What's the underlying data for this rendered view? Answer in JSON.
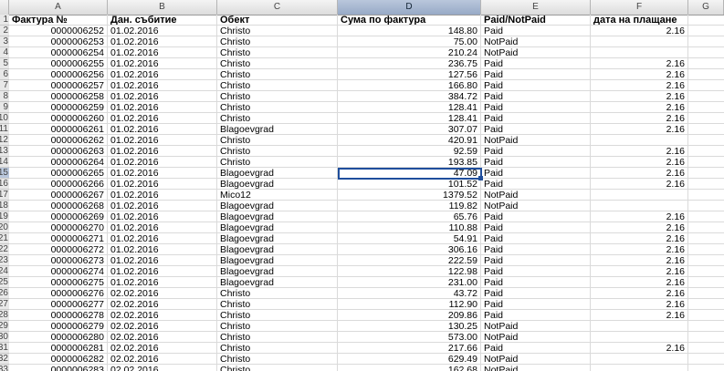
{
  "column_headers": [
    "A",
    "B",
    "C",
    "D",
    "E",
    "F",
    "G"
  ],
  "row_numbers": [
    "1",
    "2",
    "3",
    "4",
    "5",
    "6",
    "7",
    "8",
    "9",
    "10",
    "11",
    "12",
    "13",
    "14",
    "15",
    "16",
    "17",
    "18",
    "19",
    "20",
    "21",
    "22",
    "23",
    "24",
    "25",
    "26",
    "27",
    "28",
    "29",
    "30",
    "31",
    "32",
    "33"
  ],
  "header": {
    "a": "Фактура №",
    "b": "Дан. събитие",
    "c": "Обект",
    "d": "Сума по фактура",
    "e": "Paid/NotPaid",
    "f": "дата на плащане"
  },
  "rows": [
    {
      "a": "0000006252",
      "b": "01.02.2016",
      "c": "Christo",
      "d": "148.80",
      "e": "Paid",
      "f": "2.16"
    },
    {
      "a": "0000006253",
      "b": "01.02.2016",
      "c": "Christo",
      "d": "75.00",
      "e": "NotPaid",
      "f": ""
    },
    {
      "a": "0000006254",
      "b": "01.02.2016",
      "c": "Christo",
      "d": "210.24",
      "e": "NotPaid",
      "f": ""
    },
    {
      "a": "0000006255",
      "b": "01.02.2016",
      "c": "Christo",
      "d": "236.75",
      "e": "Paid",
      "f": "2.16"
    },
    {
      "a": "0000006256",
      "b": "01.02.2016",
      "c": "Christo",
      "d": "127.56",
      "e": "Paid",
      "f": "2.16"
    },
    {
      "a": "0000006257",
      "b": "01.02.2016",
      "c": "Christo",
      "d": "166.80",
      "e": "Paid",
      "f": "2.16"
    },
    {
      "a": "0000006258",
      "b": "01.02.2016",
      "c": "Christo",
      "d": "384.72",
      "e": "Paid",
      "f": "2.16"
    },
    {
      "a": "0000006259",
      "b": "01.02.2016",
      "c": "Christo",
      "d": "128.41",
      "e": "Paid",
      "f": "2.16"
    },
    {
      "a": "0000006260",
      "b": "01.02.2016",
      "c": "Christo",
      "d": "128.41",
      "e": "Paid",
      "f": "2.16"
    },
    {
      "a": "0000006261",
      "b": "01.02.2016",
      "c": "Blagoevgrad",
      "d": "307.07",
      "e": "Paid",
      "f": "2.16"
    },
    {
      "a": "0000006262",
      "b": "01.02.2016",
      "c": "Christo",
      "d": "420.91",
      "e": "NotPaid",
      "f": ""
    },
    {
      "a": "0000006263",
      "b": "01.02.2016",
      "c": "Christo",
      "d": "92.59",
      "e": "Paid",
      "f": "2.16"
    },
    {
      "a": "0000006264",
      "b": "01.02.2016",
      "c": "Christo",
      "d": "193.85",
      "e": "Paid",
      "f": "2.16"
    },
    {
      "a": "0000006265",
      "b": "01.02.2016",
      "c": "Blagoevgrad",
      "d": "47.09",
      "e": "Paid",
      "f": "2.16"
    },
    {
      "a": "0000006266",
      "b": "01.02.2016",
      "c": "Blagoevgrad",
      "d": "101.52",
      "e": "Paid",
      "f": "2.16"
    },
    {
      "a": "0000006267",
      "b": "01.02.2016",
      "c": "Mico12",
      "d": "1379.52",
      "e": "NotPaid",
      "f": ""
    },
    {
      "a": "0000006268",
      "b": "01.02.2016",
      "c": "Blagoevgrad",
      "d": "119.82",
      "e": "NotPaid",
      "f": ""
    },
    {
      "a": "0000006269",
      "b": "01.02.2016",
      "c": "Blagoevgrad",
      "d": "65.76",
      "e": "Paid",
      "f": "2.16"
    },
    {
      "a": "0000006270",
      "b": "01.02.2016",
      "c": "Blagoevgrad",
      "d": "110.88",
      "e": "Paid",
      "f": "2.16"
    },
    {
      "a": "0000006271",
      "b": "01.02.2016",
      "c": "Blagoevgrad",
      "d": "54.91",
      "e": "Paid",
      "f": "2.16"
    },
    {
      "a": "0000006272",
      "b": "01.02.2016",
      "c": "Blagoevgrad",
      "d": "306.16",
      "e": "Paid",
      "f": "2.16"
    },
    {
      "a": "0000006273",
      "b": "01.02.2016",
      "c": "Blagoevgrad",
      "d": "222.59",
      "e": "Paid",
      "f": "2.16"
    },
    {
      "a": "0000006274",
      "b": "01.02.2016",
      "c": "Blagoevgrad",
      "d": "122.98",
      "e": "Paid",
      "f": "2.16"
    },
    {
      "a": "0000006275",
      "b": "01.02.2016",
      "c": "Blagoevgrad",
      "d": "231.00",
      "e": "Paid",
      "f": "2.16"
    },
    {
      "a": "0000006276",
      "b": "02.02.2016",
      "c": "Christo",
      "d": "43.72",
      "e": "Paid",
      "f": "2.16"
    },
    {
      "a": "0000006277",
      "b": "02.02.2016",
      "c": "Christo",
      "d": "112.90",
      "e": "Paid",
      "f": "2.16"
    },
    {
      "a": "0000006278",
      "b": "02.02.2016",
      "c": "Christo",
      "d": "209.86",
      "e": "Paid",
      "f": "2.16"
    },
    {
      "a": "0000006279",
      "b": "02.02.2016",
      "c": "Christo",
      "d": "130.25",
      "e": "NotPaid",
      "f": ""
    },
    {
      "a": "0000006280",
      "b": "02.02.2016",
      "c": "Christo",
      "d": "573.00",
      "e": "NotPaid",
      "f": ""
    },
    {
      "a": "0000006281",
      "b": "02.02.2016",
      "c": "Christo",
      "d": "217.66",
      "e": "Paid",
      "f": "2.16"
    },
    {
      "a": "0000006282",
      "b": "02.02.2016",
      "c": "Christo",
      "d": "629.49",
      "e": "NotPaid",
      "f": ""
    },
    {
      "a": "0000006283",
      "b": "02.02.2016",
      "c": "Christo",
      "d": "162.68",
      "e": "NotPaid",
      "f": ""
    }
  ],
  "selected_cell": {
    "column": "D",
    "row": "15"
  },
  "colors": {
    "selection_border": "#1f4e9c",
    "header_bg": "#dcdcdc",
    "gridline": "#dadada"
  }
}
